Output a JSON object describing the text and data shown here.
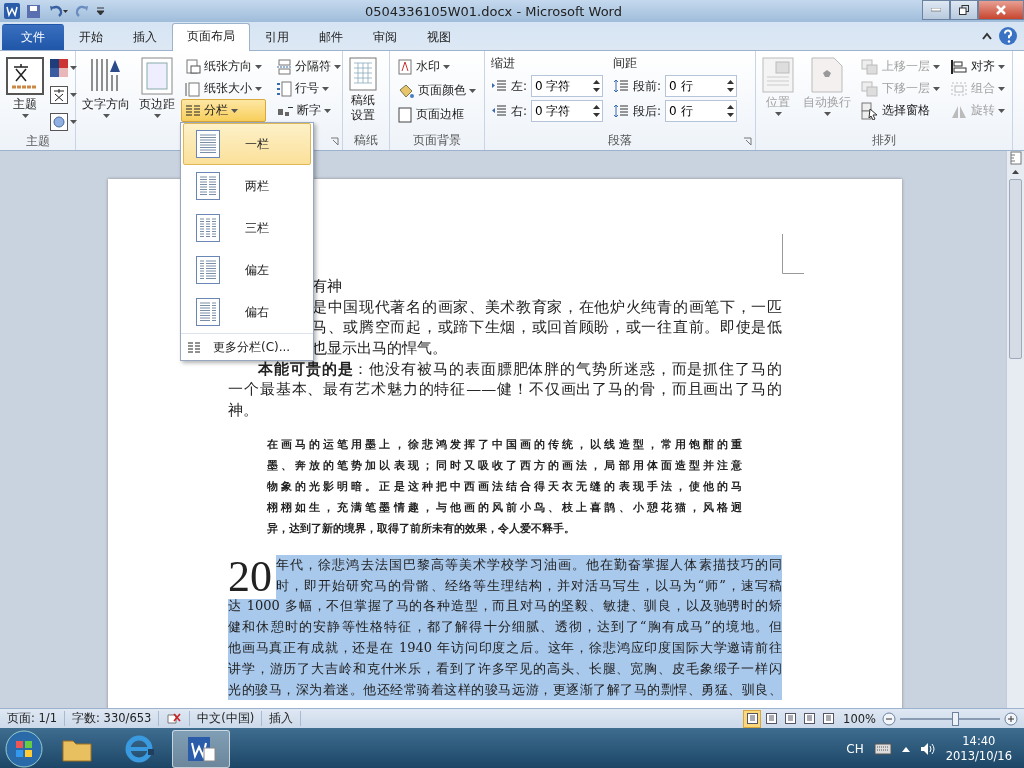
{
  "window": {
    "title": "0504336105W01.docx  -  Microsoft Word"
  },
  "tabs": [
    {
      "label": "文件",
      "kind": "file",
      "selected": false
    },
    {
      "label": "开始",
      "kind": "tab",
      "selected": false
    },
    {
      "label": "插入",
      "kind": "tab",
      "selected": false
    },
    {
      "label": "页面布局",
      "kind": "tab",
      "selected": true
    },
    {
      "label": "引用",
      "kind": "tab",
      "selected": false
    },
    {
      "label": "邮件",
      "kind": "tab",
      "selected": false
    },
    {
      "label": "审阅",
      "kind": "tab",
      "selected": false
    },
    {
      "label": "视图",
      "kind": "tab",
      "selected": false
    }
  ],
  "ribbon": {
    "themes": {
      "label": "主题",
      "button": "主题"
    },
    "page_setup": {
      "big": [
        {
          "label": "文字方向"
        },
        {
          "label": "页边距"
        }
      ],
      "small": [
        {
          "label": "纸张方向",
          "kind": "orientation",
          "active": false
        },
        {
          "label": "纸张大小",
          "kind": "size",
          "active": false
        },
        {
          "label": "分栏",
          "kind": "columns",
          "active": true
        },
        {
          "label": "分隔符",
          "kind": "breaks",
          "active": false
        },
        {
          "label": "行号",
          "kind": "linenumbers",
          "active": false
        },
        {
          "label": "断字",
          "kind": "hyphen",
          "active": false
        }
      ]
    },
    "manuscript": {
      "label": "稿纸",
      "button_lines": [
        "稿纸",
        "设置"
      ]
    },
    "background": {
      "label": "页面背景",
      "items": [
        {
          "label": "水印",
          "kind": "watermark",
          "dropdown": true
        },
        {
          "label": "页面颜色",
          "kind": "color",
          "dropdown": true
        },
        {
          "label": "页面边框",
          "kind": "border",
          "dropdown": false
        }
      ]
    },
    "paragraph": {
      "label": "段落",
      "indent": {
        "heading": "缩进",
        "fields": [
          {
            "label": "左:",
            "value": "0 字符"
          },
          {
            "label": "右:",
            "value": "0 字符"
          }
        ]
      },
      "spacing": {
        "heading": "间距",
        "fields": [
          {
            "label": "段前:",
            "value": "0 行"
          },
          {
            "label": "段后:",
            "value": "0 行"
          }
        ]
      }
    },
    "arrange": {
      "label": "排列",
      "big": [
        {
          "label": "位置",
          "disabled": true
        },
        {
          "label": "自动换行",
          "disabled": true
        }
      ],
      "small": [
        {
          "label": "上移一层",
          "kind": "forward",
          "disabled": true
        },
        {
          "label": "下移一层",
          "kind": "backward",
          "disabled": true
        },
        {
          "label": "选择窗格",
          "kind": "pane",
          "disabled": false
        },
        {
          "label": "对齐",
          "kind": "align",
          "disabled": false
        },
        {
          "label": "组合",
          "kind": "group",
          "disabled": true
        },
        {
          "label": "旋转",
          "kind": "rotate",
          "disabled": true
        }
      ]
    }
  },
  "columns_menu": {
    "items": [
      {
        "label": "一栏",
        "kind": "one",
        "selected": true
      },
      {
        "label": "两栏",
        "kind": "two",
        "selected": false
      },
      {
        "label": "三栏",
        "kind": "three",
        "selected": false
      },
      {
        "label": "偏左",
        "kind": "left",
        "selected": false
      },
      {
        "label": "偏右",
        "kind": "right",
        "selected": false
      }
    ],
    "more": "更多分栏(C)..."
  },
  "document": {
    "intro_lines": [
      {
        "text": "有神",
        "kind": "covered"
      },
      {
        "text": "是中国现代著名的画家、美术教育家，在他炉火纯青的画笔下，一匹",
        "kind": "covered"
      },
      {
        "text": "马、或腾空而起，或蹄下生烟，或回首顾盼，或一往直前。即使是低",
        "kind": "covered"
      },
      {
        "text": "也显示出马的悍气。",
        "kind": "covered"
      },
      {
        "text": "**本能可贵的是**：他没有被马的表面膘肥体胖的气势所迷惑，而是抓住了马的",
        "kind": "indent"
      },
      {
        "text": "一个最基本、最有艺术魅力的特征——健！不仅画出了马的骨，而且画出了马的",
        "kind": "full"
      },
      {
        "text": "神。",
        "kind": "last"
      }
    ],
    "quote_lines": [
      "在画马的运笔用墨上，徐悲鸿发挥了中国画的传统，以线造型，常用饱酣的重",
      "墨、奔放的笔势加以表现；同时又吸收了西方的画法，局部用体面造型并注意",
      "物象的光影明暗。正是这种把中西画法结合得天衣无缝的表现手法，使他的马",
      "栩栩如生，充满笔墨情趣，与他画的风前小鸟、枝上喜鹊、小憩花猫，风格迥",
      "异，达到了新的境界，取得了前所未有的效果，令人爱不释手。"
    ],
    "drop_cap": "20",
    "selected": true,
    "body_lines": [
      "年代，徐悲鸿去法国巴黎高等美术学校学习油画。他在勤奋掌握人体素描技巧的同",
      "时，即开始研究马的骨骼、经络等生理结构，并对活马写生，以马为“师”，速写稿",
      "达 1000 多幅，不但掌握了马的各种造型，而且对马的坚毅、敏捷、驯良，以及驰骋时的矫",
      "健和休憩时的安静等性格特征，都了解得十分细腻、透彻，达到了“胸有成马”的境地。但",
      "他画马真正有成就，还是在 1940 年访问印度之后。这年，徐悲鸿应印度国际大学邀请前往",
      "讲学，游历了大吉岭和克什米乐，看到了许多罕见的高头、长腿、宽胸、皮毛象缎子一样闪",
      "光的骏马，深为着迷。他还经常骑着这样的骏马远游，更逐渐了解了马的剽悍、勇猛、驯良、"
    ]
  },
  "status_bar": {
    "page": "页面: 1/1",
    "words": "字数: 330/653",
    "language": "中文(中国)",
    "mode": "插入",
    "views": [
      {
        "selected": true
      },
      {
        "selected": false
      },
      {
        "selected": false
      },
      {
        "selected": false
      },
      {
        "selected": false
      }
    ],
    "zoom": "100%",
    "zoom_level": {
      "level": 0.55
    }
  },
  "taskbar": {
    "apps": [
      {
        "kind": "explorer",
        "selected": false
      },
      {
        "kind": "ie",
        "selected": false
      },
      {
        "kind": "word",
        "selected": true
      }
    ],
    "language": "CH",
    "time": "14:40",
    "date": "2013/10/16"
  }
}
